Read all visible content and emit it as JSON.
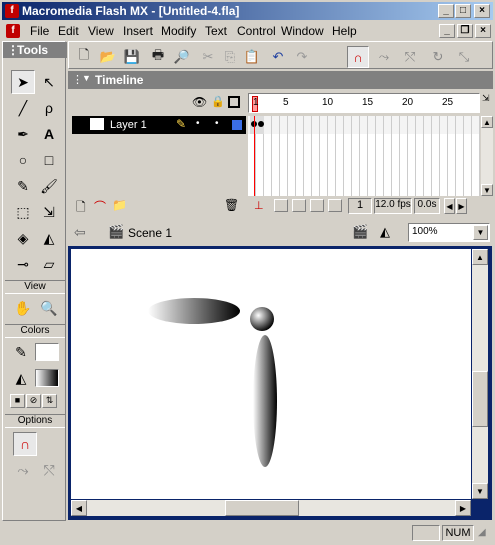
{
  "window": {
    "title": "Macromedia Flash MX - [Untitled-4.fla]",
    "minimize": "_",
    "maximize": "□",
    "close": "×"
  },
  "menu": {
    "items": [
      "File",
      "Edit",
      "View",
      "Insert",
      "Modify",
      "Text",
      "Control",
      "Window",
      "Help"
    ]
  },
  "tools": {
    "title": "Tools",
    "view_label": "View",
    "colors_label": "Colors",
    "options_label": "Options"
  },
  "timeline": {
    "title": "Timeline",
    "frame_numbers": [
      "1",
      "5",
      "10",
      "15",
      "20",
      "25"
    ],
    "layer_name": "Layer 1",
    "current_frame": "1",
    "fps": "12.0 fps",
    "time": "0.0s"
  },
  "scene": {
    "name": "Scene 1",
    "zoom": "100%"
  },
  "status": {
    "num": "NUM"
  },
  "colors": {
    "titlebar_start": "#0a246a",
    "stage_border": "#0a246a",
    "playhead": "#ff0000",
    "layer_select": "#000000"
  }
}
